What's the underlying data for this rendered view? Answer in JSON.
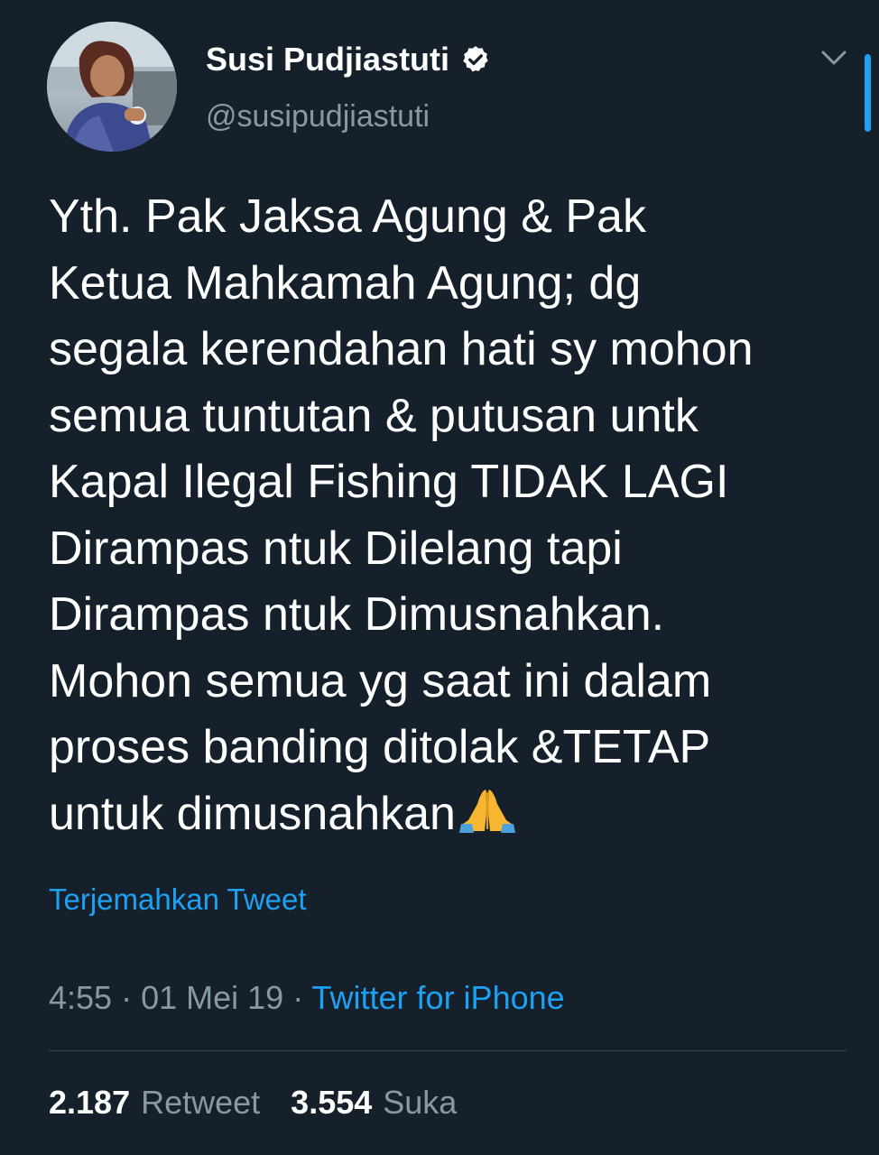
{
  "author": {
    "name": "Susi Pudjiastuti",
    "handle": "@susipudjiastuti",
    "verified": true
  },
  "tweet": {
    "lines": [
      "Yth. Pak Jaksa Agung & Pak",
      "Ketua Mahkamah Agung; dg",
      "segala kerendahan hati sy mohon",
      "semua tuntutan & putusan untk",
      "Kapal Ilegal Fishing TIDAK LAGI",
      "Dirampas ntuk Dilelang tapi",
      "Dirampas ntuk Dimusnahkan.",
      "Mohon semua yg saat ini dalam",
      "proses banding ditolak &TETAP",
      "untuk dimusnahkan"
    ],
    "trailing_emoji": "folded-hands-emoji",
    "translate_label": "Terjemahkan Tweet"
  },
  "meta": {
    "time": "4:55",
    "separator": " · ",
    "date": "01 Mei 19",
    "source": "Twitter for iPhone"
  },
  "stats": {
    "retweets_count": "2.187",
    "retweets_label": "Retweet",
    "likes_count": "3.554",
    "likes_label": "Suka"
  },
  "colors": {
    "background": "#15202b",
    "text_primary": "#ffffff",
    "text_secondary": "#8899a6",
    "accent": "#1da1f2",
    "divider": "#38444d"
  },
  "icons": {
    "verified": "verified-badge-icon",
    "menu": "chevron-down-icon"
  }
}
